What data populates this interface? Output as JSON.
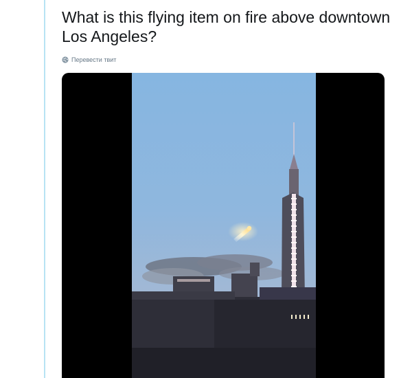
{
  "tweet": {
    "text": "What is this flying item on fire above downtown Los Angeles?",
    "translate_label": "Перевести твит",
    "translate_icon": "globe-icon"
  },
  "media": {
    "type": "video",
    "letterbox_color": "#000000"
  },
  "colors": {
    "thread_line": "#b7e3f3",
    "text": "#14171a",
    "muted": "#657786"
  }
}
